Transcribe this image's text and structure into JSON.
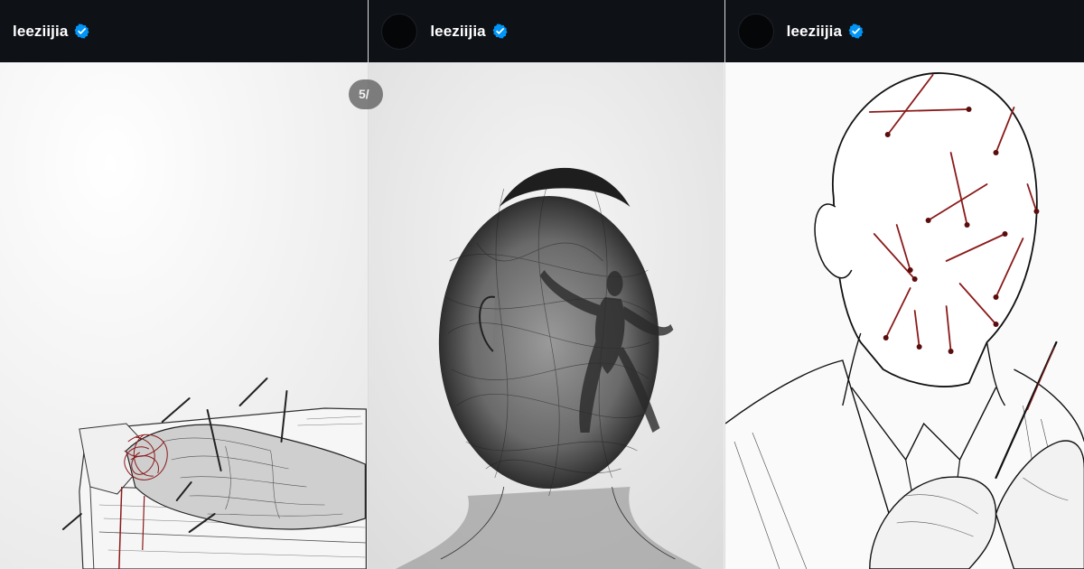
{
  "posts": [
    {
      "username": "leeziijia",
      "verified_icon": "verified-badge-icon",
      "slide_counter": "5/"
    },
    {
      "username": "leeziijia",
      "verified_icon": "verified-badge-icon"
    },
    {
      "username": "leeziijia",
      "verified_icon": "verified-badge-icon"
    }
  ],
  "colors": {
    "header_bg": "#0e1116",
    "verified_blue": "#0095f6",
    "ink": "#1a1a1a",
    "blood_red": "#8b1a1a"
  }
}
